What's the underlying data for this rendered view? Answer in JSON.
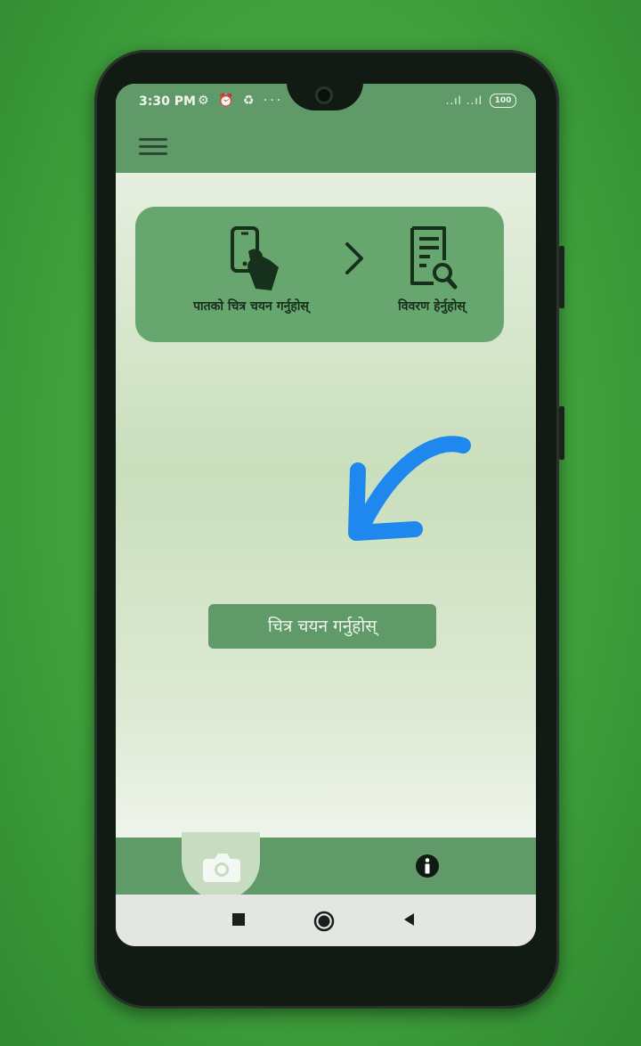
{
  "status_bar": {
    "time": "3:30 PM",
    "icons_text": "⚙ ⏰ ♻  ···",
    "signal_text": "..ıl ..ıl",
    "battery": "100"
  },
  "app_bar": {
    "menu_icon": "hamburger-menu-icon"
  },
  "steps": {
    "step1_label": "पातको चित्र चयन गर्नुहोस्",
    "step1_icon": "hand-phone-icon",
    "step2_label": "विवरण हेर्नुहोस्",
    "step2_icon": "document-search-icon",
    "separator_icon": "chevron-right-icon"
  },
  "annotation": {
    "icon": "blue-curved-arrow-icon",
    "color": "#1e88ee"
  },
  "select_button": {
    "label": "चित्र चयन गर्नुहोस्"
  },
  "bottom_nav": {
    "camera_icon": "camera-icon",
    "info_icon": "info-icon"
  },
  "system_nav": {
    "recents_icon": "square-icon",
    "home_icon": "circle-icon",
    "back_icon": "triangle-back-icon"
  },
  "colors": {
    "app_green": "#5f9a68",
    "card_green": "#68a670",
    "background": "#4fb04a"
  }
}
